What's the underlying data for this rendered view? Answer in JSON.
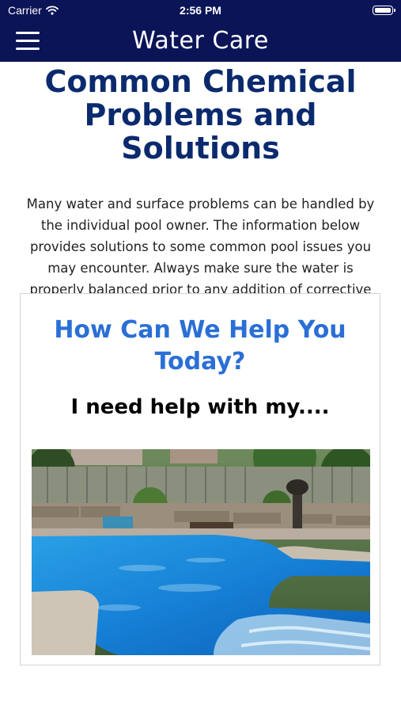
{
  "status_bar": {
    "carrier": "Carrier",
    "time": "2:56 PM"
  },
  "nav": {
    "title": "Water Care"
  },
  "main": {
    "title": "Common Chemical Problems and Solutions",
    "intro": "Many water and surface problems can be handled by the individual pool owner. The information below provides solutions to some common pool issues you may encounter. Always make sure the water is properly balanced prior to any addition of corrective chemicals.",
    "card": {
      "title": "How Can We Help You Today?",
      "subtitle": "I need help with my...."
    }
  },
  "colors": {
    "nav_bg": "#0b1457",
    "page_title": "#0b2a6e",
    "card_title": "#2a6fd6"
  }
}
